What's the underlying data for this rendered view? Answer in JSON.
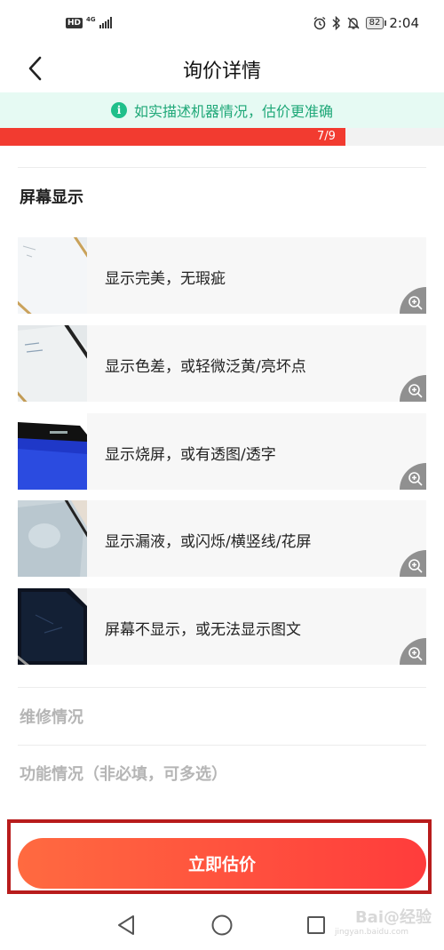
{
  "status_bar": {
    "hd": "HD",
    "network": "4G",
    "battery": "82",
    "time": "2:04",
    "icons": [
      "alarm-icon",
      "bluetooth-icon",
      "mute-icon"
    ]
  },
  "header": {
    "title": "询价详情",
    "back_icon": "chevron-left-icon"
  },
  "tip": {
    "icon": "info-icon",
    "icon_glyph": "i",
    "text": "如实描述机器情况，估价更准确"
  },
  "progress": {
    "label": "7/9",
    "fraction": 0.778,
    "color": "#f23b30"
  },
  "section": {
    "title": "屏幕显示",
    "options": [
      {
        "label": "显示完美，无瑕疵",
        "thumb": "phone-screen-perfect"
      },
      {
        "label": "显示色差，或轻微泛黄/亮坏点",
        "thumb": "phone-screen-yellowish"
      },
      {
        "label": "显示烧屏，或有透图/透字",
        "thumb": "phone-screen-burnin"
      },
      {
        "label": "显示漏液，或闪烁/横竖线/花屏",
        "thumb": "phone-screen-leak"
      },
      {
        "label": "屏幕不显示，或无法显示图文",
        "thumb": "phone-screen-black"
      }
    ]
  },
  "repair_section": {
    "title": "维修情况"
  },
  "function_section": {
    "title": "功能情况（非必填，可多选）"
  },
  "cta": {
    "label": "立即估价",
    "color_start": "#ff6a40",
    "color_end": "#ff3c3c"
  },
  "watermark": {
    "text": "Bai@经验",
    "sub": "jingyan.baidu.com"
  }
}
